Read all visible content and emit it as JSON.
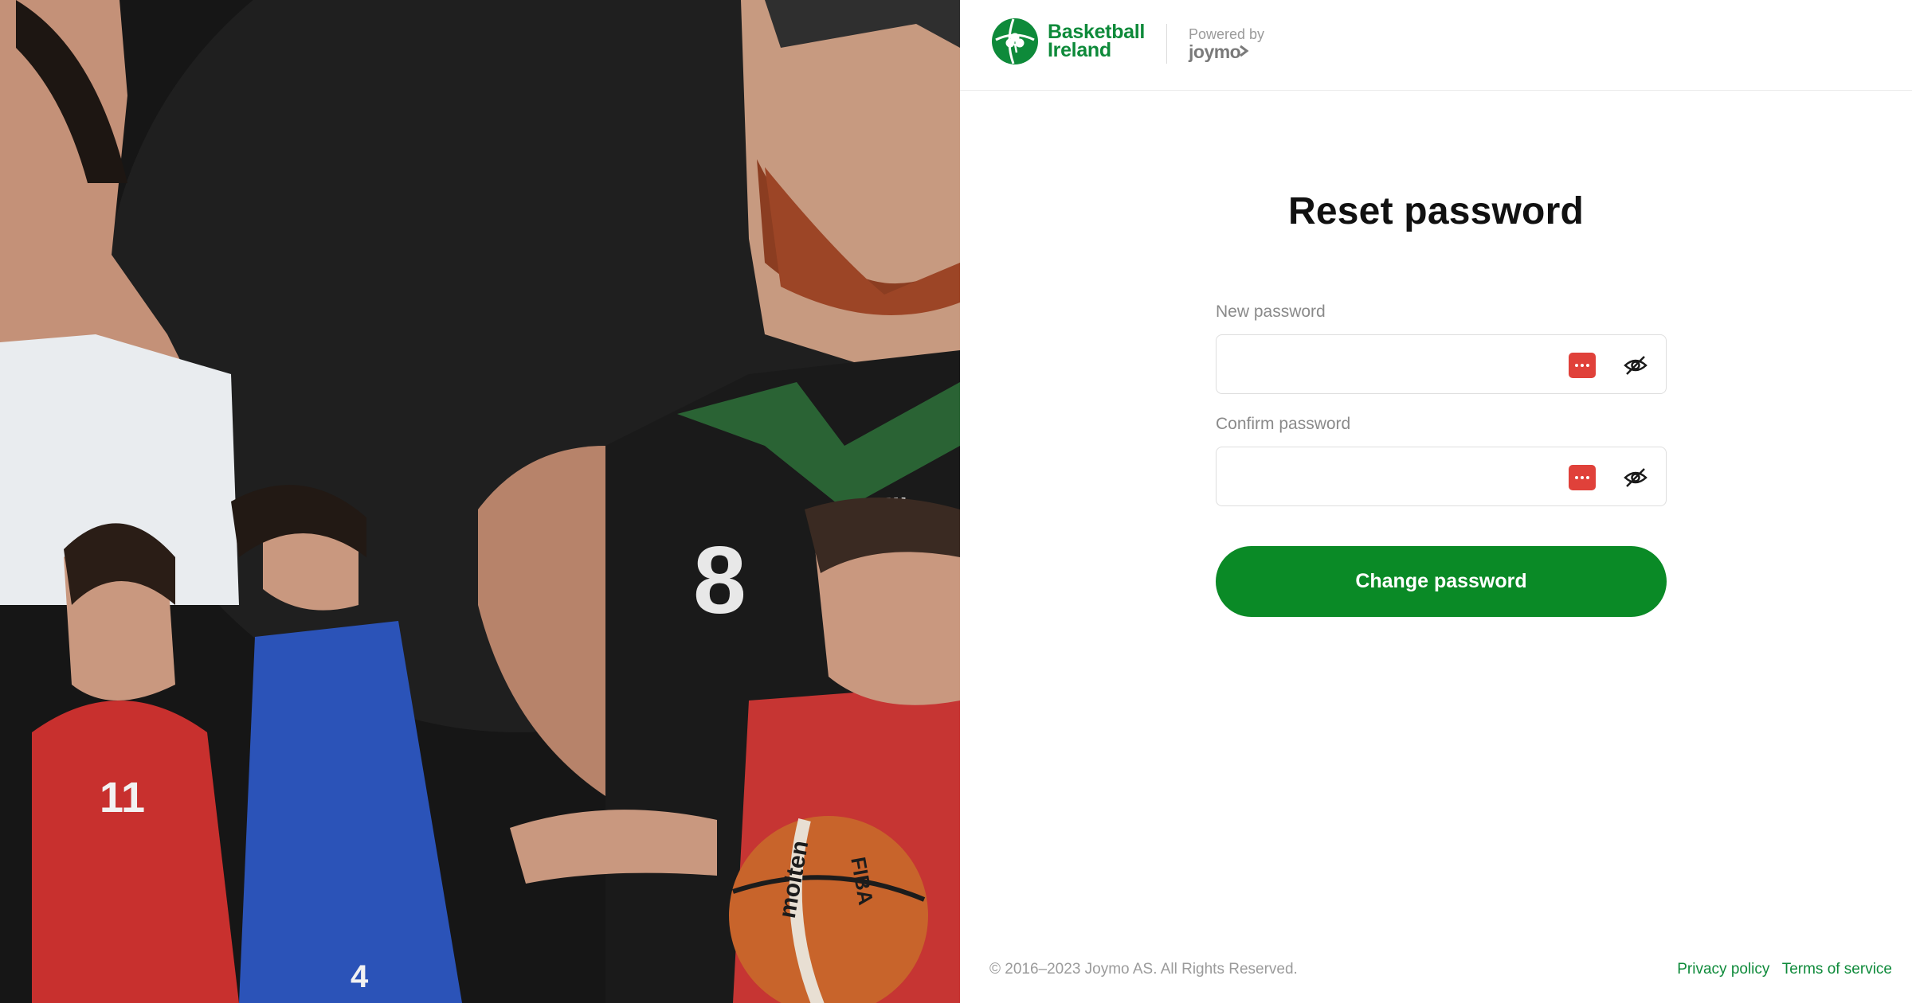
{
  "header": {
    "brand_name_line1": "Basketball",
    "brand_name_line2": "Ireland",
    "powered_label": "Powered by",
    "powered_name": "joymo"
  },
  "form": {
    "title": "Reset password",
    "new_password_label": "New password",
    "new_password_value": "",
    "confirm_password_label": "Confirm password",
    "confirm_password_value": "",
    "submit_label": "Change password"
  },
  "hero": {
    "jersey_number_center": "8",
    "jersey_brand": "oneills",
    "jersey_number_left": "11",
    "jersey_number_blue": "4",
    "ball_text_1": "molten",
    "ball_text_2": "FIBA"
  },
  "footer": {
    "copyright": "© 2016–2023 Joymo AS. All Rights Reserved.",
    "privacy_label": "Privacy policy",
    "terms_label": "Terms of service"
  },
  "colors": {
    "brand_green": "#0e8a3a",
    "button_green": "#0a8a26",
    "password_manager_red": "#e0413a"
  },
  "icons": [
    "basketball-ireland-logo-icon",
    "password-manager-icon",
    "eye-slash-icon",
    "chevron-right-icon"
  ]
}
